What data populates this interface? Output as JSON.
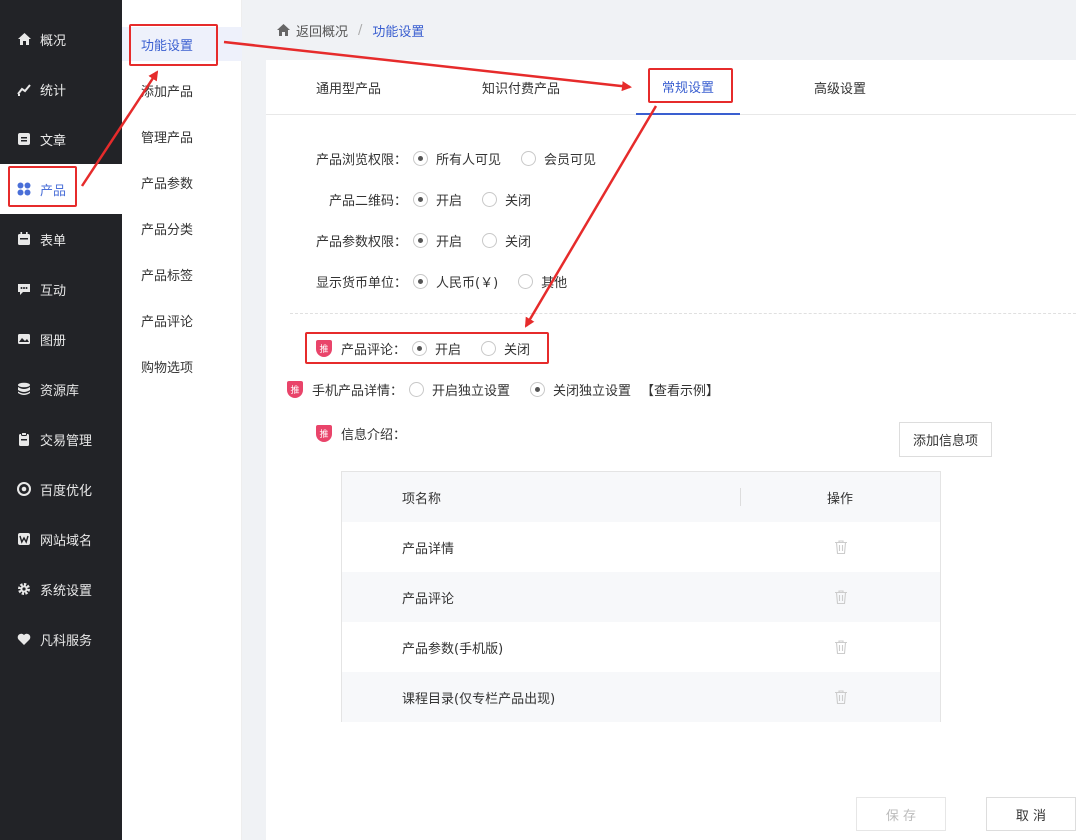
{
  "sidebar": {
    "items": [
      {
        "label": "概况",
        "icon": "home-icon"
      },
      {
        "label": "统计",
        "icon": "chart-icon"
      },
      {
        "label": "文章",
        "icon": "article-icon"
      },
      {
        "label": "产品",
        "icon": "grid-icon"
      },
      {
        "label": "表单",
        "icon": "calendar-icon"
      },
      {
        "label": "互动",
        "icon": "chat-icon"
      },
      {
        "label": "图册",
        "icon": "album-icon"
      },
      {
        "label": "资源库",
        "icon": "database-icon"
      },
      {
        "label": "交易管理",
        "icon": "clipboard-icon"
      },
      {
        "label": "百度优化",
        "icon": "target-icon"
      },
      {
        "label": "网站域名",
        "icon": "w-icon"
      },
      {
        "label": "系统设置",
        "icon": "gear-icon"
      },
      {
        "label": "凡科服务",
        "icon": "heart-icon"
      }
    ]
  },
  "subnav": {
    "items": [
      "功能设置",
      "添加产品",
      "管理产品",
      "产品参数",
      "产品分类",
      "产品标签",
      "产品评论",
      "购物选项"
    ]
  },
  "breadcrumb": {
    "back": "返回概况",
    "separator": "/",
    "current": "功能设置"
  },
  "tabs": [
    "通用型产品",
    "知识付费产品",
    "常规设置",
    "高级设置"
  ],
  "settings": {
    "browse": {
      "label": "产品浏览权限：",
      "opt1": "所有人可见",
      "opt2": "会员可见"
    },
    "qrcode": {
      "label": "产品二维码：",
      "opt1": "开启",
      "opt2": "关闭"
    },
    "param": {
      "label": "产品参数权限：",
      "opt1": "开启",
      "opt2": "关闭"
    },
    "currency": {
      "label": "显示货币单位：",
      "opt1": "人民币(￥)",
      "opt2": "其他"
    },
    "comment": {
      "badge": "推",
      "label": "产品评论：",
      "opt1": "开启",
      "opt2": "关闭"
    },
    "mobile": {
      "badge": "推",
      "label": "手机产品详情：",
      "opt1": "开启独立设置",
      "opt2": "关闭独立设置",
      "link": "【查看示例】"
    },
    "info": {
      "badge": "推",
      "label": "信息介绍："
    }
  },
  "add_info_button": "添加信息项",
  "table": {
    "headers": [
      "项名称",
      "操作"
    ],
    "rows": [
      "产品详情",
      "产品评论",
      "产品参数(手机版)",
      "课程目录(仅专栏产品出现)"
    ]
  },
  "footer": {
    "save": "保 存",
    "cancel": "取 消"
  },
  "colors": {
    "accent": "#3a5fd0",
    "annotation": "#e62b2b",
    "badge": "#e9446a"
  }
}
